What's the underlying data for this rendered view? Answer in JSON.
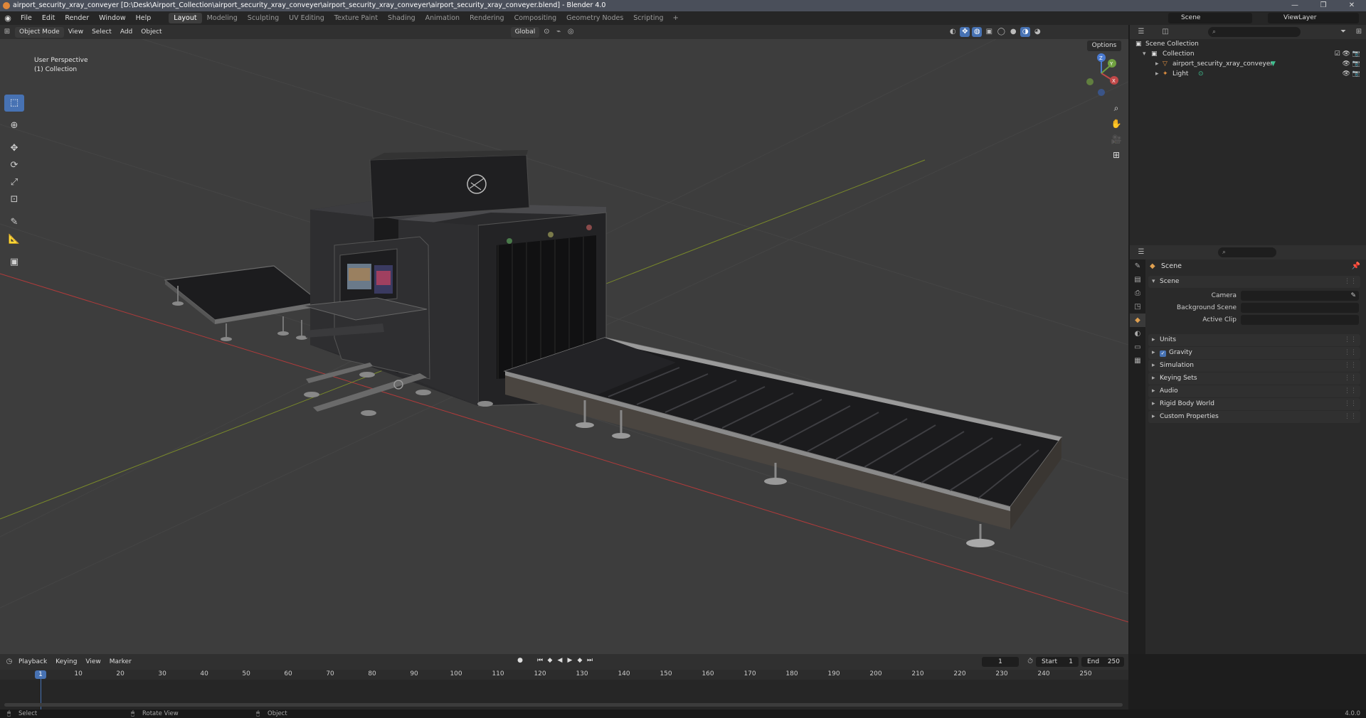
{
  "window": {
    "title": "airport_security_xray_conveyer [D:\\Desk\\Airport_Collection\\airport_security_xray_conveyer\\airport_security_xray_conveyer\\airport_security_xray_conveyer.blend] - Blender 4.0",
    "controls": [
      "—",
      "❐",
      "✕"
    ]
  },
  "menubar": {
    "menus": [
      "File",
      "Edit",
      "Render",
      "Window",
      "Help"
    ],
    "workspaces": [
      "Layout",
      "Modeling",
      "Sculpting",
      "UV Editing",
      "Texture Paint",
      "Shading",
      "Animation",
      "Rendering",
      "Compositing",
      "Geometry Nodes",
      "Scripting"
    ],
    "active_workspace": "Layout",
    "add_workspace": "+",
    "scene": "Scene",
    "view_layer": "ViewLayer"
  },
  "viewport_header": {
    "mode": "Object Mode",
    "menus": [
      "View",
      "Select",
      "Add",
      "Object"
    ],
    "orientation": "Global",
    "options": "Options"
  },
  "viewport": {
    "perspective": "User Perspective",
    "collection": "(1) Collection",
    "gizmo_axes": [
      "X",
      "Y",
      "Z"
    ],
    "colors": {
      "background": "#3d3d3d",
      "x_axis": "#b13b3b",
      "y_axis": "#7a8a2a",
      "grid": "#454545"
    }
  },
  "toolbar": {
    "tools": [
      "select-box",
      "cursor",
      "move",
      "rotate",
      "scale",
      "transform",
      "annotate",
      "measure",
      "add-cube"
    ]
  },
  "outliner": {
    "root": "Scene Collection",
    "collection": "Collection",
    "items": [
      {
        "name": "airport_security_xray_conveyer",
        "type": "mesh"
      },
      {
        "name": "Light",
        "type": "light"
      }
    ]
  },
  "properties": {
    "context": "Scene",
    "section": "Scene",
    "fields": [
      {
        "label": "Camera",
        "value": ""
      },
      {
        "label": "Background Scene",
        "value": ""
      },
      {
        "label": "Active Clip",
        "value": ""
      }
    ],
    "panels": [
      "Units",
      "Gravity",
      "Simulation",
      "Keying Sets",
      "Audio",
      "Rigid Body World",
      "Custom Properties"
    ],
    "gravity_checked": true
  },
  "timeline": {
    "menus": [
      "Playback",
      "Keying",
      "View",
      "Marker"
    ],
    "current_frame": "1",
    "start_label": "Start",
    "start": "1",
    "end_label": "End",
    "end": "250",
    "ruler": [
      "10",
      "20",
      "30",
      "40",
      "50",
      "60",
      "70",
      "80",
      "90",
      "100",
      "110",
      "120",
      "130",
      "140",
      "150",
      "160",
      "170",
      "180",
      "190",
      "200",
      "210",
      "220",
      "230",
      "240",
      "250"
    ],
    "playhead": "1"
  },
  "statusbar": {
    "left": "Select",
    "middle": "Rotate View",
    "right": "Object",
    "version": "4.0.0"
  }
}
